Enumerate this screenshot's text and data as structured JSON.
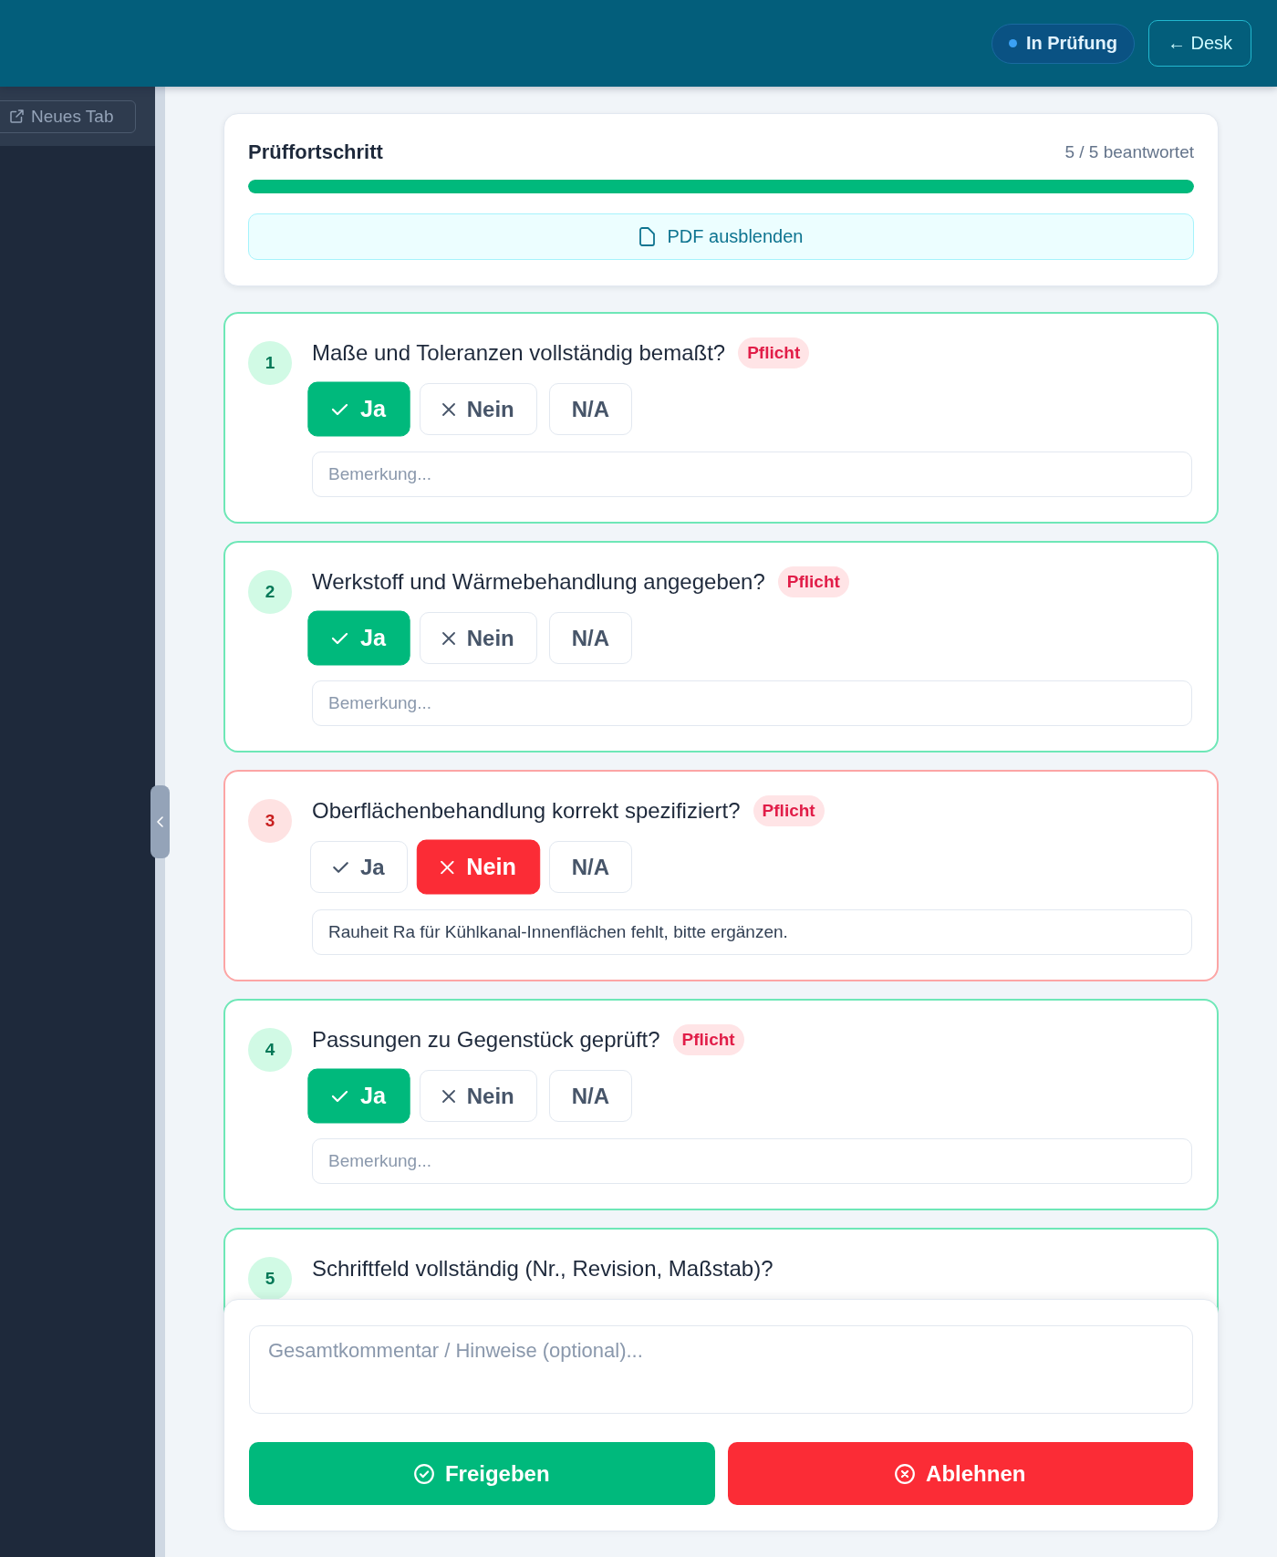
{
  "header": {
    "status": {
      "label": "In Prüfung"
    },
    "back_button": {
      "label": "← Desk"
    }
  },
  "sidebar": {
    "new_tab_button": {
      "label": "Neues Tab"
    }
  },
  "progress": {
    "title": "Prüffortschritt",
    "count": "5 / 5 beantwortet",
    "level": 1,
    "pdf_button": {
      "label": "PDF ausblenden"
    }
  },
  "questions": [
    {
      "number": "1",
      "text": "Maße und Toleranzen vollständig bemaßt?",
      "required": true,
      "badge": "Pflicht",
      "failed": false,
      "options": [
        {
          "kind": "yes",
          "label": "Ja",
          "selected": true
        },
        {
          "kind": "no",
          "label": "Nein",
          "selected": false
        },
        {
          "kind": "na",
          "label": "N/A",
          "selected": false
        }
      ],
      "remark": {
        "placeholder": "Bemerkung..."
      }
    },
    {
      "number": "2",
      "text": "Werkstoff und Wärmebehandlung angegeben?",
      "required": true,
      "badge": "Pflicht",
      "failed": false,
      "options": [
        {
          "kind": "yes",
          "label": "Ja",
          "selected": true
        },
        {
          "kind": "no",
          "label": "Nein",
          "selected": false
        },
        {
          "kind": "na",
          "label": "N/A",
          "selected": false
        }
      ],
      "remark": {
        "placeholder": "Bemerkung..."
      }
    },
    {
      "number": "3",
      "text": "Oberflächenbehandlung korrekt spezifiziert?",
      "required": true,
      "badge": "Pflicht",
      "failed": true,
      "options": [
        {
          "kind": "yes",
          "label": "Ja",
          "selected": false
        },
        {
          "kind": "no",
          "label": "Nein",
          "selected": true
        },
        {
          "kind": "na",
          "label": "N/A",
          "selected": false
        }
      ],
      "remark": {
        "value": "Rauheit Ra für Kühlkanal-Innenflächen fehlt, bitte ergänzen."
      }
    },
    {
      "number": "4",
      "text": "Passungen zu Gegenstück geprüft?",
      "required": true,
      "badge": "Pflicht",
      "failed": false,
      "options": [
        {
          "kind": "yes",
          "label": "Ja",
          "selected": true
        },
        {
          "kind": "no",
          "label": "Nein",
          "selected": false
        },
        {
          "kind": "na",
          "label": "N/A",
          "selected": false
        }
      ],
      "remark": {
        "placeholder": "Bemerkung..."
      }
    },
    {
      "number": "5",
      "text": "Schriftfeld vollständig (Nr., Revision, Maßstab)?",
      "required": false,
      "failed": false
    }
  ],
  "footer": {
    "comment": {
      "placeholder": "Gesamtkommentar / Hinweise (optional)..."
    },
    "buttons": [
      {
        "kind": "approve",
        "label": "Freigeben"
      },
      {
        "kind": "reject",
        "label": "Ablehnen"
      }
    ]
  }
}
